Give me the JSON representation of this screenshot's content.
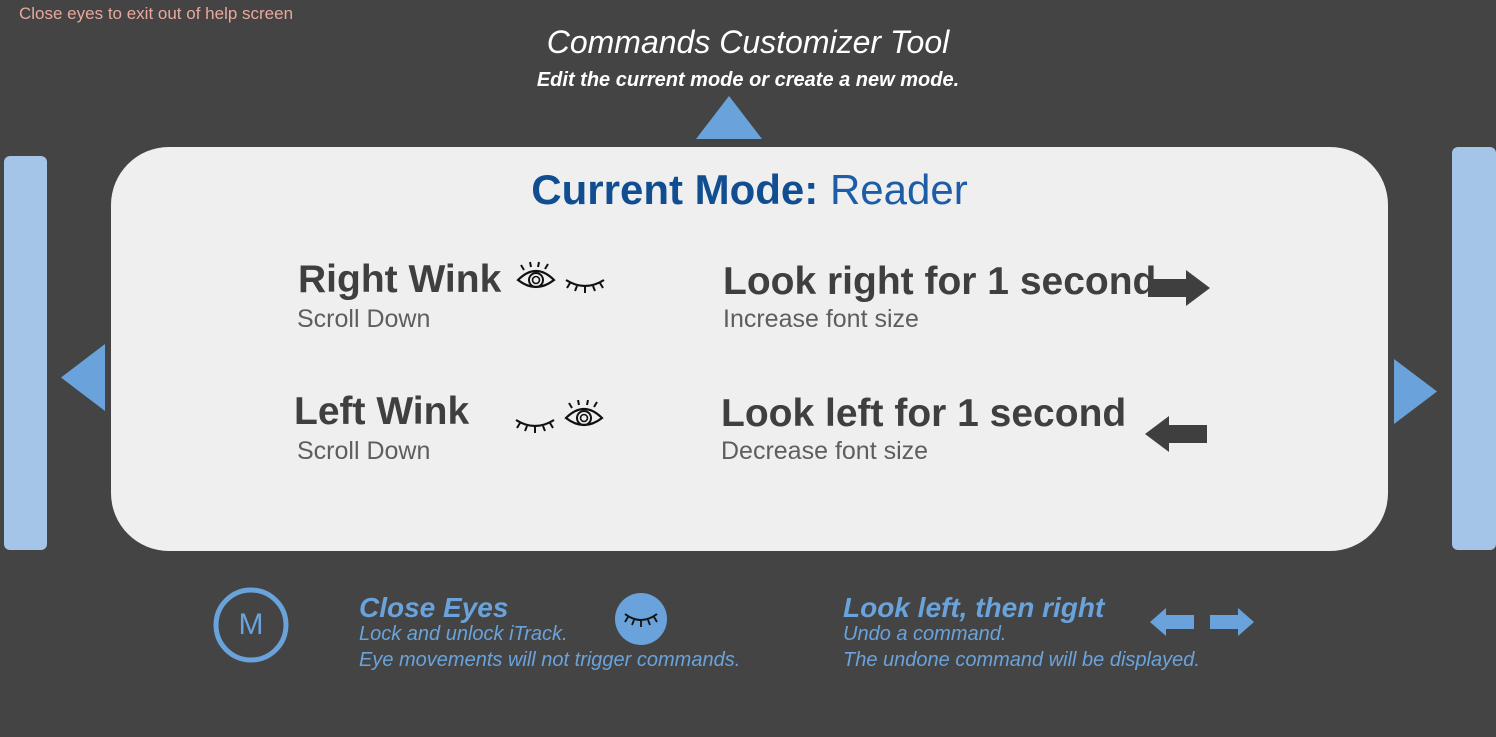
{
  "hint": "Close eyes to exit out of help screen",
  "header": {
    "title": "Commands Customizer Tool",
    "subtitle": "Edit the current mode or create a new mode."
  },
  "mode": {
    "label": "Current Mode:",
    "value": "Reader"
  },
  "commands": [
    {
      "title": "Right Wink",
      "description": "Scroll Down",
      "icon": "right-wink-icon"
    },
    {
      "title": "Look right for 1 second",
      "description": "Increase font size",
      "icon": "arrow-right-icon"
    },
    {
      "title": "Left Wink",
      "description": "Scroll Down",
      "icon": "left-wink-icon"
    },
    {
      "title": "Look left for 1 second",
      "description": "Decrease font size",
      "icon": "arrow-left-icon"
    }
  ],
  "bottom": {
    "m_label": "M",
    "close_eyes": {
      "title": "Close Eyes",
      "line1": "Lock and unlock iTrack.",
      "line2": "Eye movements will not trigger commands.",
      "icon": "closed-eye-icon"
    },
    "look_left_right": {
      "title": "Look left, then right",
      "line1": "Undo a command.",
      "line2": "The undone command will be displayed.",
      "icon": "left-right-arrows-icon"
    }
  },
  "colors": {
    "background": "#444444",
    "card": "#efefef",
    "accent": "#6aa3db",
    "side_panel": "#a4c4e8",
    "mode_label": "#104d91",
    "hint": "#e8a89c"
  }
}
